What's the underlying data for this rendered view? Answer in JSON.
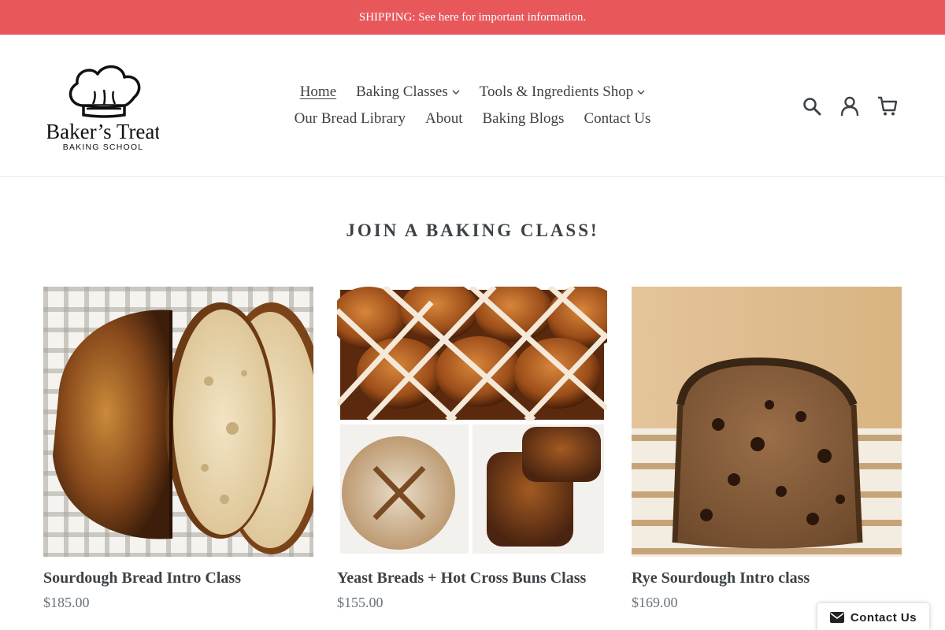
{
  "announcement": {
    "text": "SHIPPING: See here for important information."
  },
  "brand": {
    "name": "Baker’s Treat",
    "tagline": "BAKING SCHOOL"
  },
  "nav": {
    "row1": [
      {
        "label": "Home",
        "active": true
      },
      {
        "label": "Baking Classes",
        "dropdown": true
      },
      {
        "label": "Tools & Ingredients Shop",
        "dropdown": true
      }
    ],
    "row2": [
      {
        "label": "Our Bread Library"
      },
      {
        "label": "About"
      },
      {
        "label": "Baking Blogs"
      },
      {
        "label": "Contact Us"
      }
    ]
  },
  "header_icons": [
    "search-icon",
    "account-icon",
    "cart-icon"
  ],
  "section": {
    "title": "JOIN A BAKING CLASS!"
  },
  "products": [
    {
      "name": "Sourdough Bread Intro Class",
      "price": "$185.00"
    },
    {
      "name": "Yeast Breads + Hot Cross Buns Class",
      "price": "$155.00"
    },
    {
      "name": "Rye Sourdough Intro class",
      "price": "$169.00"
    }
  ],
  "contact_widget": {
    "label": "Contact Us",
    "icon": "envelope-icon"
  },
  "colors": {
    "announcement_bg": "#e8585b",
    "text": "#3d4246",
    "price": "#69727b"
  }
}
